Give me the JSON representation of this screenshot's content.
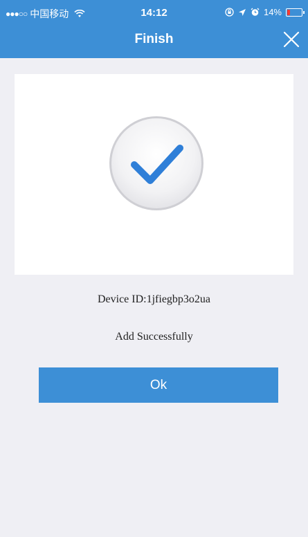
{
  "status_bar": {
    "signal": "●●●○○",
    "carrier": "中国移动",
    "time": "14:12",
    "battery_percent": "14%",
    "icons": [
      "wifi-icon",
      "lock-rotation-icon",
      "location-icon",
      "alarm-icon",
      "battery-icon"
    ]
  },
  "nav": {
    "title": "Finish",
    "close_icon": "close-icon"
  },
  "result": {
    "icon": "checkmark-icon",
    "device_id": "Device ID:1jfiegbp3o2ua",
    "message": "Add Successfully"
  },
  "ok_button": {
    "label": "Ok"
  },
  "colors": {
    "accent": "#3d8fd6",
    "background": "#efeff4",
    "check": "#2f7fd8"
  }
}
